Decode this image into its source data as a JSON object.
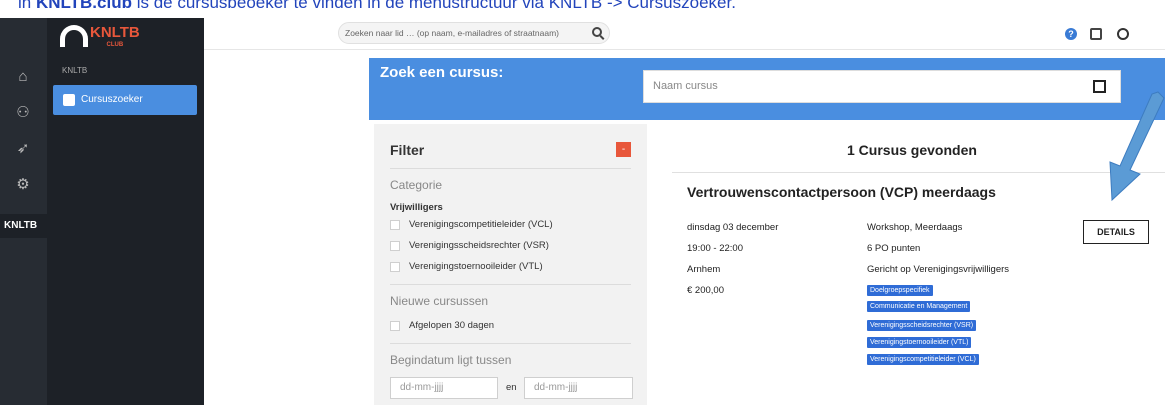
{
  "caption": {
    "prefix": "in ",
    "strong": "KNLTB.club",
    "text": " is de cursusbeoeker te vinden in de menustructuur via KNLTB -> Cursuszoeker."
  },
  "header": {
    "logo_text": "KNLTB",
    "logo_sub": "CLUB",
    "search_placeholder": "Zoeken naar lid … (op naam, e-mailadres of straatnaam)",
    "help_icon": "question-icon",
    "clipboard_icon": "clipboard-icon",
    "user_icon": "user-icon"
  },
  "rail": {
    "items": [
      {
        "icon": "home-icon",
        "glyph": "⌂"
      },
      {
        "icon": "people-icon",
        "glyph": "⚇"
      },
      {
        "icon": "send-icon",
        "glyph": "➶"
      },
      {
        "icon": "settings-icon",
        "glyph": "⚙"
      }
    ],
    "section_label": "KNLTB"
  },
  "sidebar": {
    "section": "KNLTB",
    "active_item": "Cursuszoeker"
  },
  "banner": {
    "title": "Zoek een cursus:",
    "input_placeholder": "Naam cursus"
  },
  "filter": {
    "title": "Filter",
    "collapse": "-",
    "category_heading": "Categorie",
    "group": "Vrijwilligers",
    "options": [
      "Verenigingscompetitieleider (VCL)",
      "Verenigingsscheidsrechter (VSR)",
      "Verenigingstoernooileider (VTL)"
    ],
    "new_heading": "Nieuwe cursussen",
    "new_option": "Afgelopen 30 dagen",
    "date_heading": "Begindatum ligt tussen",
    "date_from_placeholder": "dd-mm-jjjj",
    "date_sep": "en",
    "date_to_placeholder": "dd-mm-jjjj"
  },
  "results": {
    "count_text": "1 Cursus gevonden",
    "course": {
      "title": "Vertrouwenscontactpersoon (VCP) meerdaags",
      "date": "dinsdag 03 december",
      "time": "19:00 - 22:00",
      "location": "Arnhem",
      "price": "€ 200,00",
      "type": "Workshop, Meerdaags",
      "points": "6 PO punten",
      "audience": "Gericht op Verenigingsvrijwilligers",
      "tags": [
        "Doelgroepspecifiek",
        "Communicatie en Management",
        "Verenigingsscheidsrechter (VSR)",
        "Verenigingstoernooileider (VTL)",
        "Verenigingscompetitieleider (VCL)"
      ],
      "details_label": "DETAILS"
    }
  }
}
